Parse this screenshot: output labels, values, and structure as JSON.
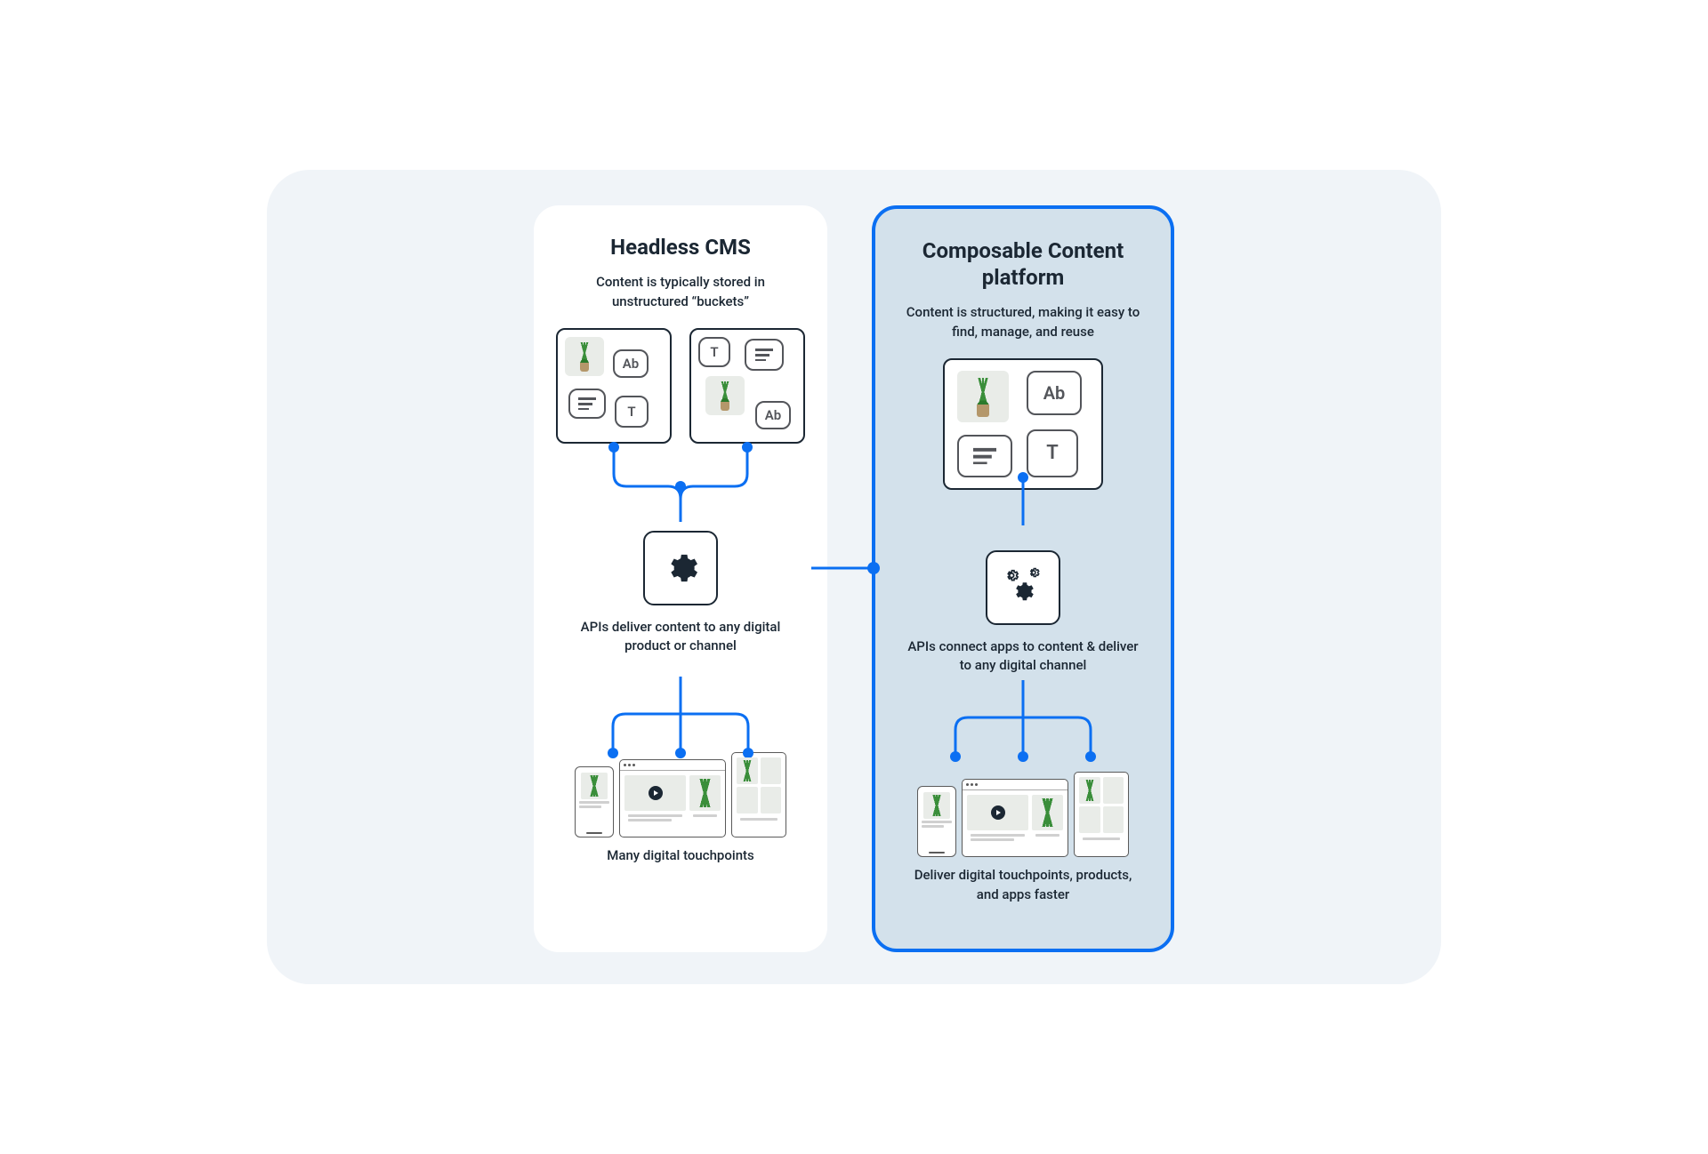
{
  "left": {
    "title": "Headless CMS",
    "desc_top": "Content is typically stored in unstructured “buckets”",
    "desc_mid": "APIs deliver content to any digital product or channel",
    "desc_bottom": "Many digital touchpoints",
    "icons": {
      "ab": "Ab",
      "t": "T"
    }
  },
  "right": {
    "title": "Composable Content platform",
    "desc_top": "Content is structured, making it easy to find, manage, and reuse",
    "desc_mid": "APIs connect apps to content & deliver to any digital channel",
    "desc_bottom": "Deliver digital touchpoints, products, and apps faster",
    "icons": {
      "ab": "Ab",
      "t": "T"
    }
  },
  "colors": {
    "accent": "#0b6ff2",
    "panel_right_bg": "#d3e1eb",
    "page_bg": "#f0f4f8"
  }
}
